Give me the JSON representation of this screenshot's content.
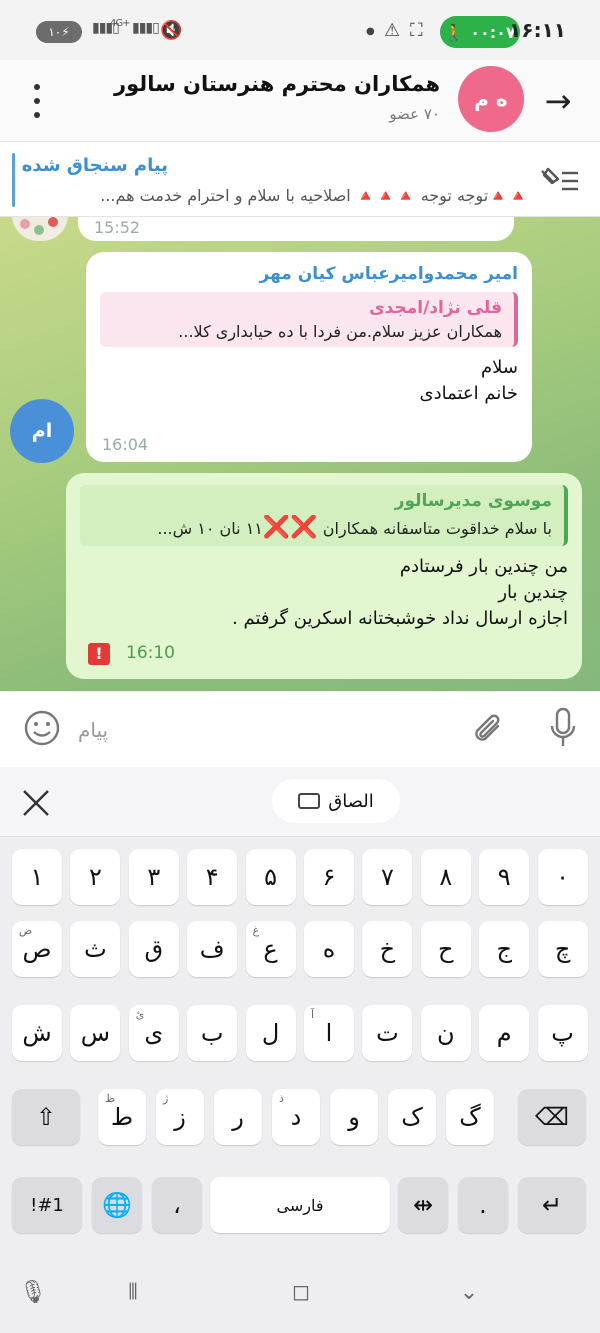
{
  "status_bar": {
    "time": "۱۶:۱۱",
    "activity_timer": "۰۰:۰۷",
    "battery": "۱۰",
    "network": "4G+"
  },
  "header": {
    "back_icon": "arrow-right-icon",
    "avatar_initials": "ه م",
    "avatar_color": "#ef6a8a",
    "title": "همکاران محترم هنرستان سالور",
    "members": "۷۰ عضو"
  },
  "pinned": {
    "title": "پیام سنجاق شده",
    "text": "🔺🔺توجه توجه 🔺🔺🔺 اصلاحیه با سلام و احترام خدمت هم..."
  },
  "messages": [
    {
      "id": "m0",
      "time": "15:52"
    },
    {
      "id": "m1",
      "sender": "امیر محمدوامیرعباس کیان مهر",
      "avatar_initials": "ام",
      "reply_name": "قلی نژاد/امجدی",
      "reply_text": "همکاران عزیز سلام.من فردا با ده حیابداری کلا...",
      "lines": [
        "سلام",
        "خانم اعتمادی"
      ],
      "time": "16:04"
    },
    {
      "id": "m2",
      "reply_name": "موسوی مدیرسالور",
      "reply_text_a": "با سلام خداقوت  متاسفانه همکاران ",
      "reply_marks": "❌❌",
      "reply_text_b": "۱۱ نان ۱۰ ش...",
      "lines": [
        "من چندین بار فرستادم",
        "چندین بار",
        "اجازه ارسال نداد خوشبختانه اسکرین گرفتم ."
      ],
      "time": "16:10",
      "error_mark": "!"
    }
  ],
  "input": {
    "placeholder": "پیام",
    "emoji_icon": "smile-icon",
    "attach_icon": "paperclip-icon",
    "mic_icon": "microphone-icon"
  },
  "keyboard": {
    "paste_label": "الصاق",
    "row_numbers": [
      "۰",
      "۹",
      "۸",
      "۷",
      "۶",
      "۵",
      "۴",
      "۳",
      "۲",
      "۱"
    ],
    "row1": [
      {
        "k": "چ",
        "s": ""
      },
      {
        "k": "ج",
        "s": ""
      },
      {
        "k": "ح",
        "s": ""
      },
      {
        "k": "خ",
        "s": ""
      },
      {
        "k": "ه",
        "s": ""
      },
      {
        "k": "ع",
        "s": "غ"
      },
      {
        "k": "ف",
        "s": ""
      },
      {
        "k": "ق",
        "s": ""
      },
      {
        "k": "ث",
        "s": ""
      },
      {
        "k": "ص",
        "s": "ض"
      }
    ],
    "row2": [
      {
        "k": "پ",
        "s": ""
      },
      {
        "k": "م",
        "s": ""
      },
      {
        "k": "ن",
        "s": ""
      },
      {
        "k": "ت",
        "s": ""
      },
      {
        "k": "ا",
        "s": "آ"
      },
      {
        "k": "ل",
        "s": ""
      },
      {
        "k": "ب",
        "s": ""
      },
      {
        "k": "ی",
        "s": "ئ"
      },
      {
        "k": "س",
        "s": ""
      },
      {
        "k": "ش",
        "s": ""
      }
    ],
    "row3": [
      {
        "k": "گ",
        "s": ""
      },
      {
        "k": "ک",
        "s": ""
      },
      {
        "k": "و",
        "s": ""
      },
      {
        "k": "د",
        "s": "ذ"
      },
      {
        "k": "ر",
        "s": ""
      },
      {
        "k": "ز",
        "s": "ژ"
      },
      {
        "k": "ط",
        "s": "ظ"
      }
    ],
    "symbols_label": "!#1",
    "comma_label": "،",
    "space_label": "فارسی",
    "period_label": "."
  }
}
